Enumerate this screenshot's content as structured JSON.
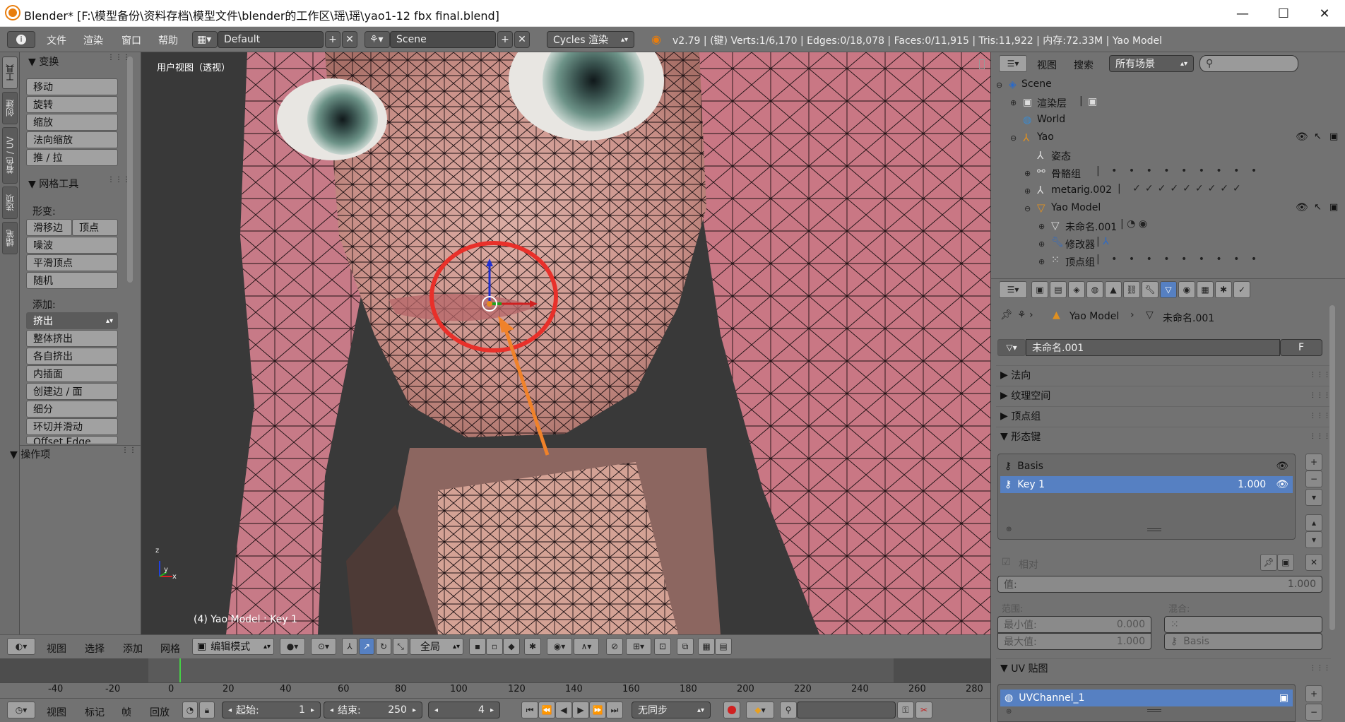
{
  "window": {
    "title": "Blender* [F:\\模型备份\\资料存档\\模型文件\\blender的工作区\\瑶\\瑶\\yao1-12 fbx final.blend]",
    "minimize": "—",
    "maximize": "☐",
    "close": "✕"
  },
  "infobar": {
    "menus": [
      "文件",
      "渲染",
      "窗口",
      "帮助"
    ],
    "layout": "Default",
    "scene": "Scene",
    "engine": "Cycles 渲染",
    "stats": "v2.79 | (键) Verts:1/6,170 | Edges:0/18,078 | Faces:0/11,915 | Tris:11,922 | 内存:72.33M | Yao Model"
  },
  "tabs": [
    "工具",
    "创建",
    "着色 / UV",
    "选项",
    "蜡笔"
  ],
  "toolshelf": {
    "transform_header": "变换",
    "transform_buttons": [
      "移动",
      "旋转",
      "缩放",
      "法向缩放",
      "推 / 拉"
    ],
    "mesh_tools_header": "网格工具",
    "deform_label": "形变:",
    "slide_edge": "滑移边",
    "vertex": "顶点",
    "deform_buttons": [
      "噪波",
      "平滑顶点",
      "随机"
    ],
    "add_label": "添加:",
    "extrude": "挤出",
    "add_buttons": [
      "整体挤出",
      "各自挤出",
      "内插面",
      "创建边 / 面",
      "细分",
      "环切并滑动",
      "Offset Edge Slide"
    ],
    "operator_header": "操作项"
  },
  "viewport": {
    "view_label": "用户视图（透视）",
    "object_label": "(4) Yao Model : Key 1",
    "axis_z": "z",
    "axis_y": "y",
    "axis_x": "x"
  },
  "view3d_header": {
    "menus": [
      "视图",
      "选择",
      "添加",
      "网格"
    ],
    "mode": "编辑模式",
    "orientation": "全局"
  },
  "timeline": {
    "ticks": [
      "-40",
      "-20",
      "0",
      "20",
      "40",
      "60",
      "80",
      "100",
      "120",
      "140",
      "160",
      "180",
      "200",
      "220",
      "240",
      "260",
      "280"
    ],
    "menus": [
      "视图",
      "标记",
      "帧",
      "回放"
    ],
    "start_label": "起始:",
    "start": "1",
    "end_label": "结束:",
    "end": "250",
    "current": "4",
    "sync": "无同步"
  },
  "outliner": {
    "menus": [
      "视图",
      "搜索"
    ],
    "filter": "所有场景",
    "rows": [
      {
        "label": "Scene",
        "indent": 0
      },
      {
        "label": "渲染层",
        "indent": 1
      },
      {
        "label": "World",
        "indent": 1
      },
      {
        "label": "Yao",
        "indent": 1
      },
      {
        "label": "姿态",
        "indent": 2
      },
      {
        "label": "骨骼组",
        "indent": 2
      },
      {
        "label": "metarig.002",
        "indent": 2
      },
      {
        "label": "Yao Model",
        "indent": 2
      },
      {
        "label": "未命名.001",
        "indent": 3
      },
      {
        "label": "修改器",
        "indent": 3
      },
      {
        "label": "顶点组",
        "indent": 3
      }
    ]
  },
  "properties": {
    "breadcrumb_object": "Yao Model",
    "breadcrumb_mesh": "未命名.001",
    "datablock": "未命名.001",
    "fake_user": "F",
    "panels": [
      "法向",
      "纹理空间",
      "顶点组",
      "形态键"
    ],
    "shape_keys": [
      {
        "name": "Basis",
        "value": ""
      },
      {
        "name": "Key 1",
        "value": "1.000"
      }
    ],
    "relative": "相对",
    "value_label": "值:",
    "value": "1.000",
    "range_label": "范围:",
    "blend_label": "混合:",
    "min_label": "最小值:",
    "min": "0.000",
    "max_label": "最大值:",
    "max": "1.000",
    "blend_target": "Basis",
    "uv_panel": "UV 贴图",
    "uv_name": "UVChannel_1"
  }
}
